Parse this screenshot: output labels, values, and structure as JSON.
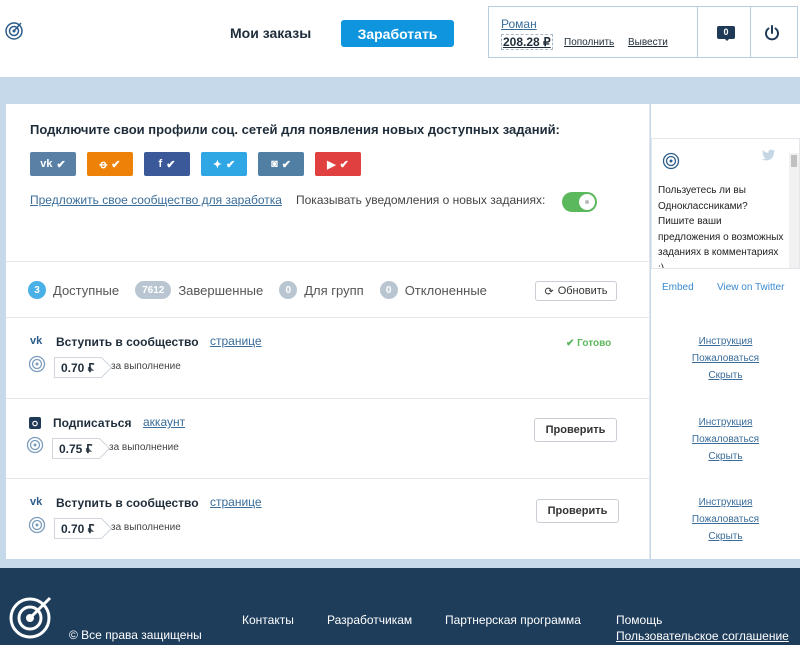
{
  "header": {
    "orders_label": "Мои заказы",
    "earn_button": "Заработать",
    "account": {
      "name": "Роман",
      "balance": "208.28 ₽",
      "topup_link": "Пополнить",
      "withdraw_link": "Вывести",
      "messages_count": "0"
    }
  },
  "connect": {
    "title": "Подключите свои профили соц. сетей для появления новых доступных заданий:",
    "networks": [
      {
        "name": "vk",
        "glyph": "vk",
        "color": "#5a80a6"
      },
      {
        "name": "odnoklassniki",
        "glyph": "ok",
        "color": "#ee8208"
      },
      {
        "name": "facebook",
        "glyph": "f",
        "color": "#3b5998"
      },
      {
        "name": "twitter",
        "glyph": "t",
        "color": "#2fa7e5"
      },
      {
        "name": "instagram",
        "glyph": "ig",
        "color": "#517fa4"
      },
      {
        "name": "youtube",
        "glyph": "yt",
        "color": "#e04040"
      }
    ],
    "suggest_link": "Предложить свое сообщество для заработка",
    "notify_label": "Показывать уведомления о новых заданиях:",
    "notify_enabled": true
  },
  "tabs": [
    {
      "count": "3",
      "label": "Доступные",
      "active": true
    },
    {
      "count": "7612",
      "label": "Завершенные",
      "active": false
    },
    {
      "count": "0",
      "label": "Для групп",
      "active": false
    },
    {
      "count": "0",
      "label": "Отклоненные",
      "active": false
    }
  ],
  "refresh_button": "Обновить",
  "tasks": [
    {
      "network": "vk",
      "title": "Вступить в сообщество",
      "link": "странице",
      "price": "0.70 ₽",
      "price_label": "за выполнение",
      "status": "Готово",
      "action": ""
    },
    {
      "network": "instagram",
      "title": "Подписаться",
      "link": "аккаунт",
      "price": "0.75 ₽",
      "price_label": "за выполнение",
      "status": "",
      "action": "Проверить"
    },
    {
      "network": "vk",
      "title": "Вступить в сообщество",
      "link": "странице",
      "price": "0.70 ₽",
      "price_label": "за выполнение",
      "status": "",
      "action": "Проверить"
    }
  ],
  "task_links": {
    "instruction": "Инструкция",
    "complain": "Пожаловаться",
    "hide": "Скрыть"
  },
  "twitter_widget": {
    "text": "Пользуетесь ли вы Одноклассниками? Пишите ваши предложения о возможных заданиях в комментариях ;)",
    "embed": "Embed",
    "view_on_twitter": "View on Twitter"
  },
  "footer": {
    "copyright": "© Все права защищены",
    "links": [
      "Контакты",
      "Разработчикам",
      "Партнерская программа",
      "Помощь"
    ],
    "agreement": "Пользовательское соглашение"
  }
}
